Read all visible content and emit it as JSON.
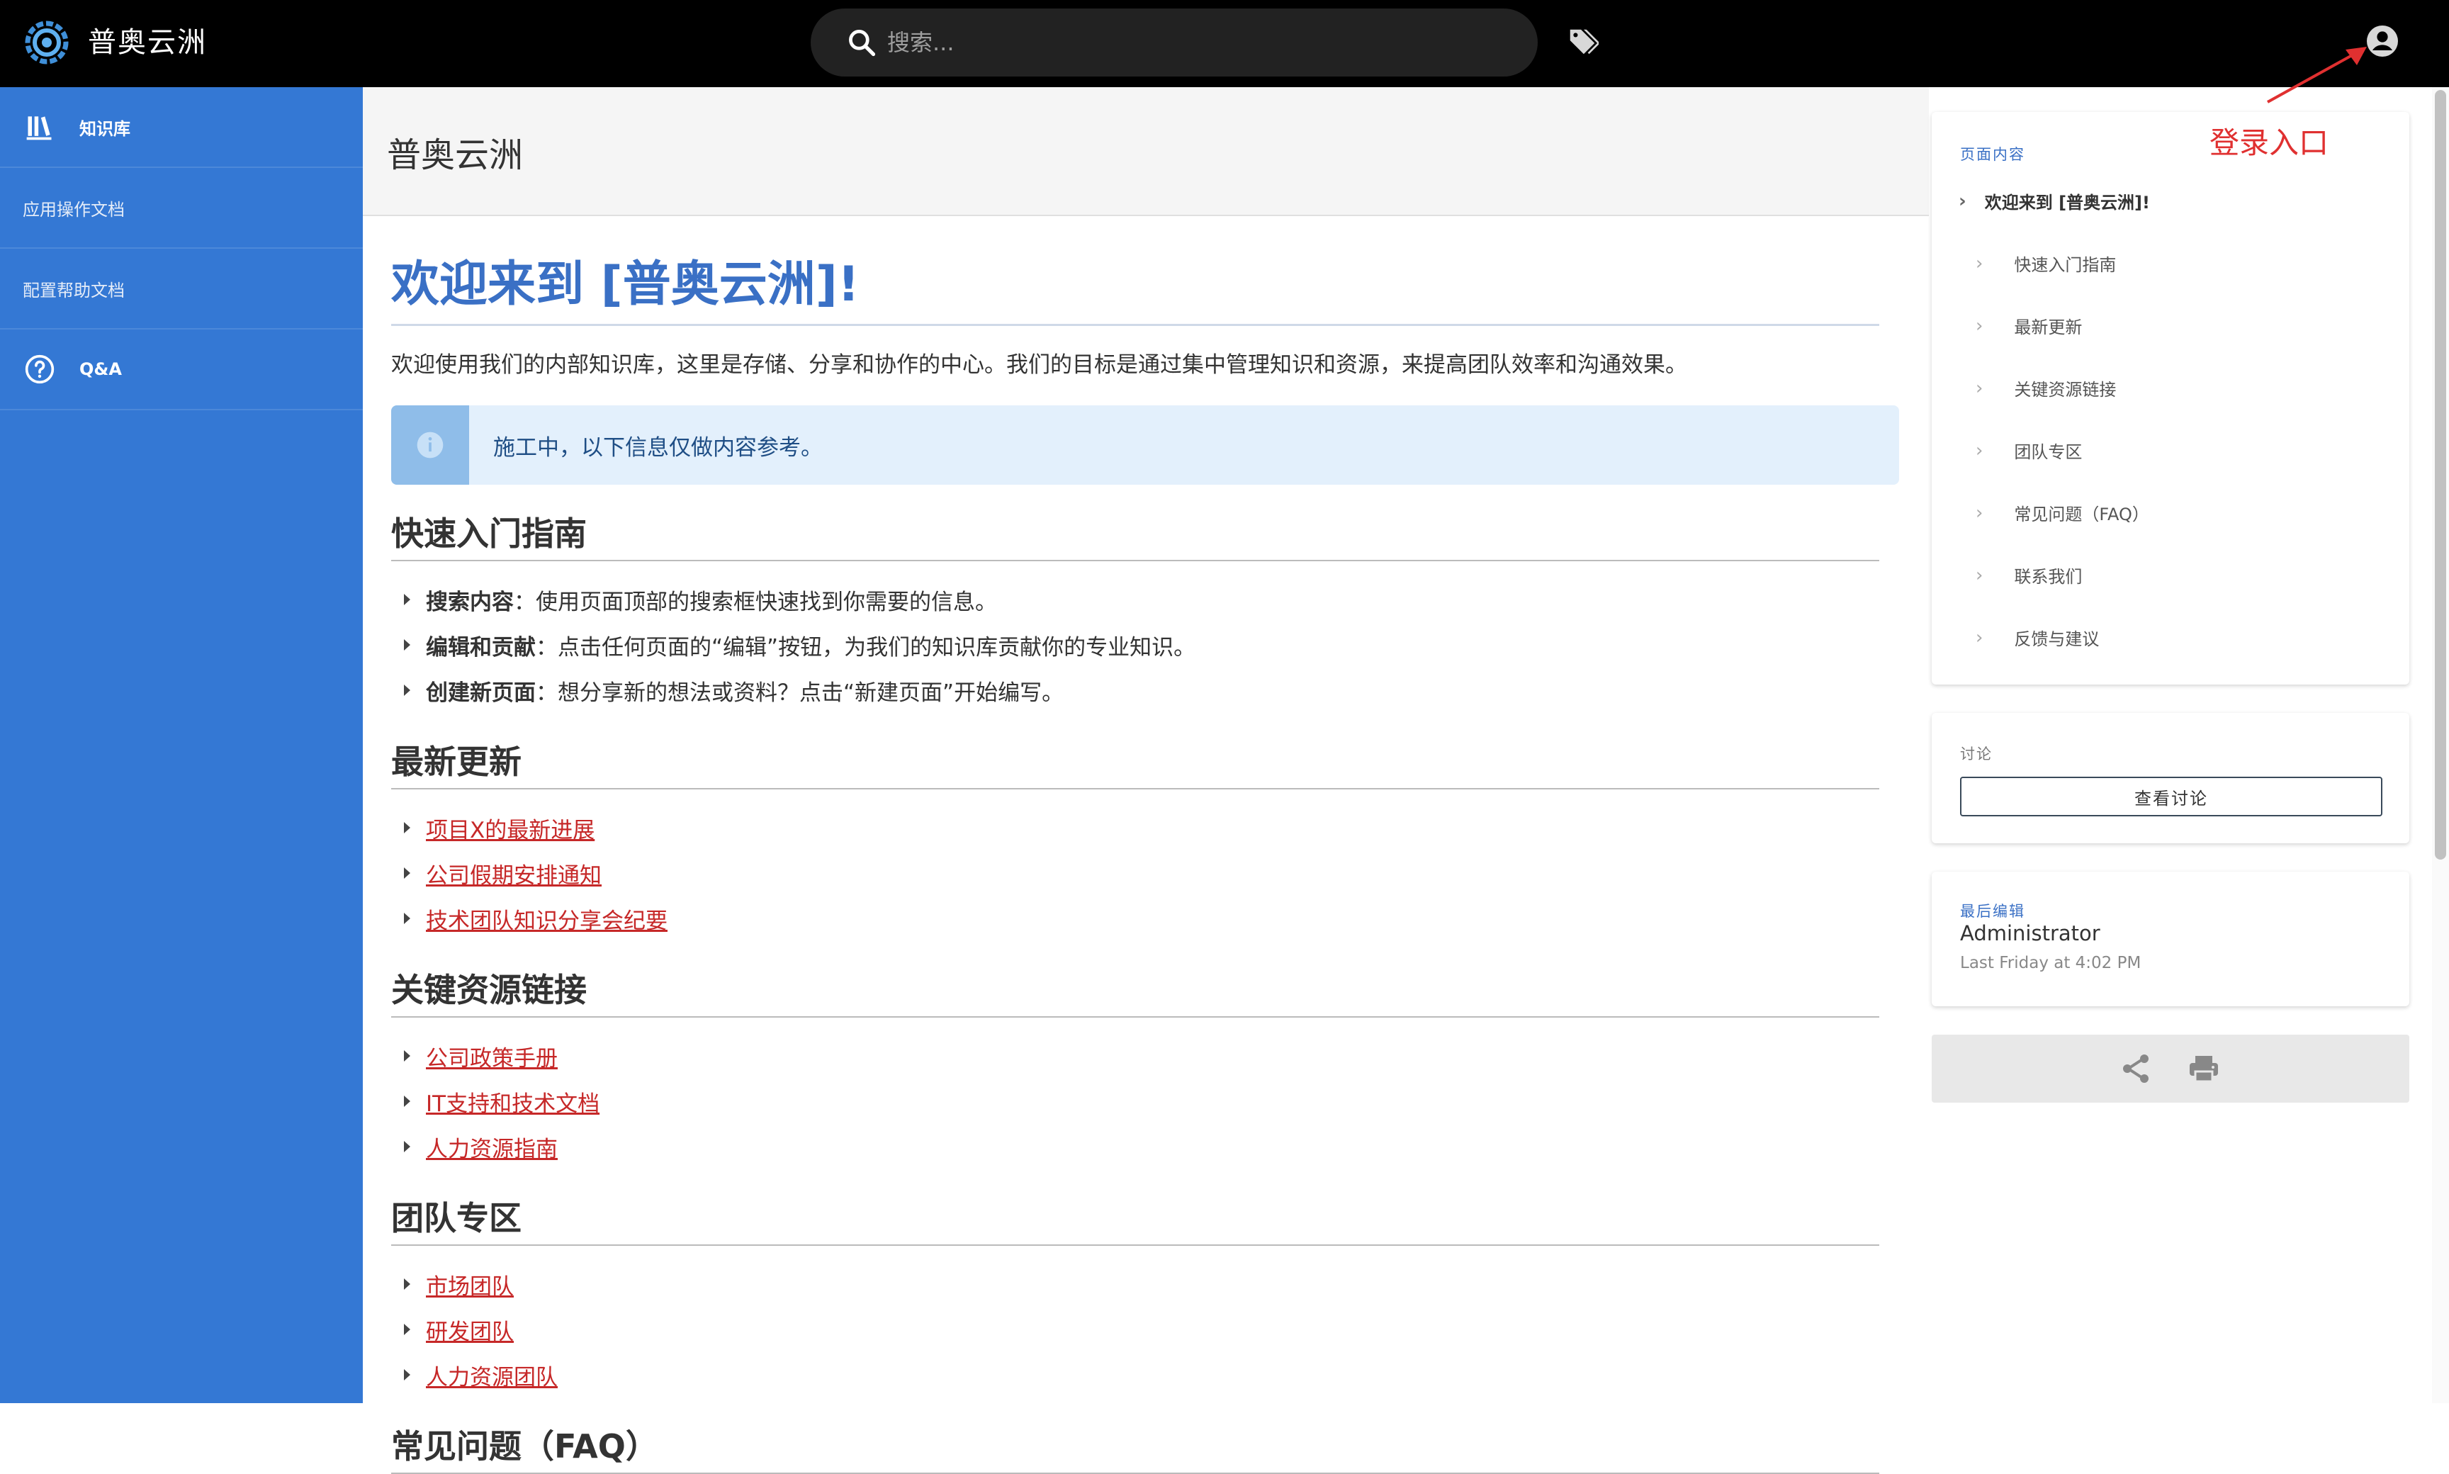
{
  "header": {
    "app_title": "普奥云洲",
    "search_placeholder": "搜索..."
  },
  "sidebar": {
    "items": [
      {
        "label": "知识库",
        "icon": "library-icon"
      },
      {
        "label": "应用操作文档"
      },
      {
        "label": "配置帮助文档"
      },
      {
        "label": "Q&A",
        "icon": "help-circle-icon"
      }
    ]
  },
  "page": {
    "title": "普奥云洲"
  },
  "content": {
    "main_title": "欢迎来到 [普奥云洲]!",
    "intro": "欢迎使用我们的内部知识库，这里是存储、分享和协作的中心。我们的目标是通过集中管理知识和资源，来提高团队效率和沟通效果。",
    "callout": "施工中，以下信息仅做内容参考。",
    "sections": [
      {
        "heading": "快速入门指南",
        "items": [
          {
            "bold": "搜索内容",
            "text": "：使用页面顶部的搜索框快速找到你需要的信息。"
          },
          {
            "bold": "编辑和贡献",
            "text": "：点击任何页面的“编辑”按钮，为我们的知识库贡献你的专业知识。"
          },
          {
            "bold": "创建新页面",
            "text": "：想分享新的想法或资料？点击“新建页面”开始编写。"
          }
        ]
      },
      {
        "heading": "最新更新",
        "links": [
          "项目X的最新进展",
          "公司假期安排通知",
          "技术团队知识分享会纪要"
        ]
      },
      {
        "heading": "关键资源链接",
        "links": [
          "公司政策手册",
          "IT支持和技术文档",
          "人力资源指南"
        ]
      },
      {
        "heading": "团队专区",
        "links": [
          "市场团队",
          "研发团队",
          "人力资源团队"
        ]
      },
      {
        "heading": "常见问题（FAQ）"
      }
    ]
  },
  "toc": {
    "title": "页面内容",
    "root": "欢迎来到 [普奥云洲]!",
    "items": [
      "快速入门指南",
      "最新更新",
      "关键资源链接",
      "团队专区",
      "常见问题（FAQ）",
      "联系我们",
      "反馈与建议"
    ]
  },
  "annotation": {
    "login_hint": "登录入口"
  },
  "discussion": {
    "label": "讨论",
    "button": "查看讨论"
  },
  "last_edit": {
    "label": "最后编辑",
    "name": "Administrator",
    "time": "Last Friday at 4:02 PM"
  },
  "colors": {
    "sidebar": "#3478d4",
    "accent": "#3a70c5",
    "link": "#c62828",
    "annotation": "#e03030"
  }
}
